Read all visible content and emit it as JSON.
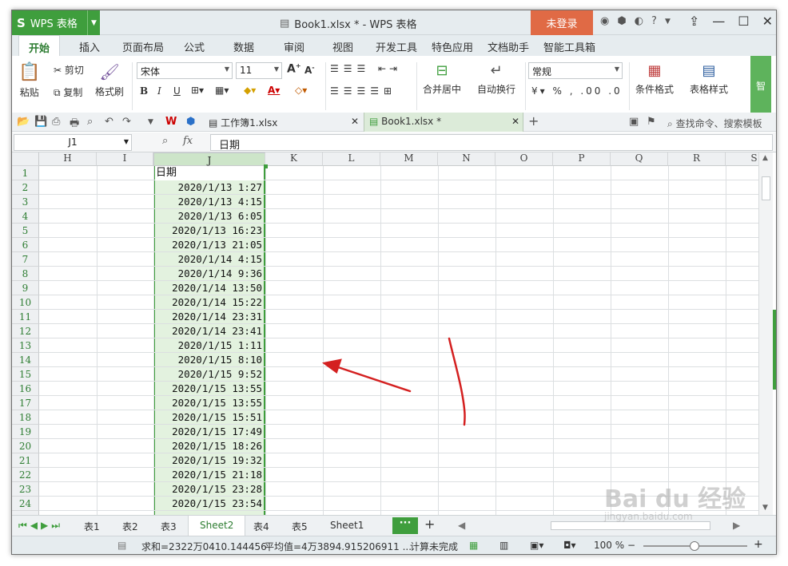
{
  "app": {
    "logo": "S",
    "name": "WPS 表格",
    "doc_title": "Book1.xlsx * - WPS 表格",
    "login": "未登录"
  },
  "menu": [
    "开始",
    "插入",
    "页面布局",
    "公式",
    "数据",
    "审阅",
    "视图",
    "开发工具",
    "特色应用",
    "文档助手",
    "智能工具箱"
  ],
  "ribbon": {
    "paste": "粘贴",
    "cut": "剪切",
    "copy": "复制",
    "format_painter": "格式刷",
    "font": "宋体",
    "font_size": "11",
    "merge": "合并居中",
    "wrap": "自动换行",
    "number_format": "常规",
    "cond_format": "条件格式",
    "table_style": "表格样式",
    "smart": "智"
  },
  "doc_tabs": [
    {
      "label": "工作簿1.xlsx"
    },
    {
      "label": "Book1.xlsx *"
    }
  ],
  "search_cmd": "查找命令、搜索模板",
  "formula": {
    "cell_ref": "J1",
    "fx": "fx",
    "content": "日期"
  },
  "columns": [
    "H",
    "I",
    "J",
    "K",
    "L",
    "M",
    "N",
    "O",
    "P",
    "Q",
    "R",
    "S"
  ],
  "rows": [
    "1",
    "2",
    "3",
    "4",
    "5",
    "6",
    "7",
    "8",
    "9",
    "10",
    "11",
    "12",
    "13",
    "14",
    "15",
    "16",
    "17",
    "18",
    "19",
    "20",
    "21",
    "22",
    "23",
    "24"
  ],
  "columnJ": [
    "日期",
    "2020/1/13 1:27",
    "2020/1/13 4:15",
    "2020/1/13 6:05",
    "2020/1/13 16:23",
    "2020/1/13 21:05",
    "2020/1/14 4:15",
    "2020/1/14 9:36",
    "2020/1/14 13:50",
    "2020/1/14 15:22",
    "2020/1/14 23:31",
    "2020/1/14 23:41",
    "2020/1/15 1:11",
    "2020/1/15 8:10",
    "2020/1/15 9:52",
    "2020/1/15 13:55",
    "2020/1/15 13:55",
    "2020/1/15 15:51",
    "2020/1/15 17:49",
    "2020/1/15 18:26",
    "2020/1/15 19:32",
    "2020/1/15 21:18",
    "2020/1/15 23:28",
    "2020/1/15 23:54"
  ],
  "sheets": [
    "表1",
    "表2",
    "表3",
    "Sheet2",
    "表4",
    "表5",
    "Sheet1"
  ],
  "status": {
    "sum": "求和=2322万0410.144456",
    "avg": "平均值=4万3894.915206911 ...",
    "calc": "计算未完成",
    "zoom": "100 %"
  },
  "watermark": {
    "main": "Bai du 经验",
    "sub": "jingyan.baidu.com"
  },
  "colors": {
    "accent": "#3f9e3d",
    "login": "#e06a45",
    "selection": "#e3f2df",
    "annotation": "#d42020"
  }
}
